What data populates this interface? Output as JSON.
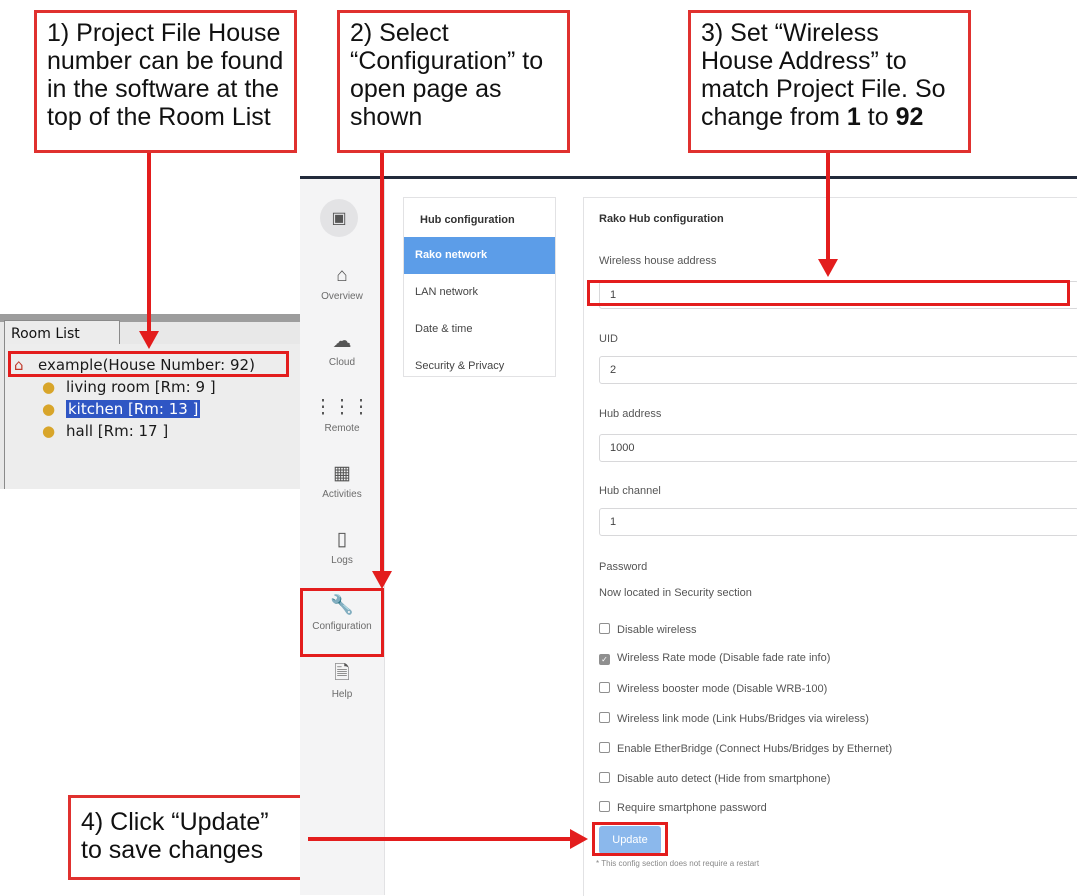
{
  "callouts": {
    "c1": "1) Project File House number can be found in the software at the top of the Room List",
    "c2": "2) Select “Configuration” to open page as shown",
    "c3_pre": "3) Set “Wireless House Address” to match Project File. So change from ",
    "c3_from": "1",
    "c3_mid": " to ",
    "c3_to": "92",
    "c4": "4) Click “Update” to save changes"
  },
  "room_list": {
    "tab": "Room List",
    "house": "example(House Number: 92)",
    "rooms": [
      "living room [Rm: 9 ]",
      "kitchen [Rm: 13 ]",
      "hall [Rm: 17 ]"
    ],
    "selected_room": "kitchen [Rm: 13 ]"
  },
  "nav": {
    "items": [
      {
        "label": "Overview",
        "icon": "home-icon"
      },
      {
        "label": "Cloud",
        "icon": "cloud-icon"
      },
      {
        "label": "Remote",
        "icon": "sliders-icon"
      },
      {
        "label": "Activities",
        "icon": "grid-icon"
      },
      {
        "label": "Logs",
        "icon": "notebook-icon"
      },
      {
        "label": "Configuration",
        "icon": "wrench-icon"
      },
      {
        "label": "Help",
        "icon": "document-icon"
      }
    ],
    "active": "Configuration"
  },
  "subnav": {
    "header": "Hub configuration",
    "items": [
      "Rako network",
      "LAN network",
      "Date & time",
      "Security & Privacy"
    ],
    "active": "Rako network"
  },
  "config": {
    "title": "Rako Hub configuration",
    "wireless_house_address_label": "Wireless house address",
    "wireless_house_address": "1",
    "uid_label": "UID",
    "uid": "2",
    "hub_address_label": "Hub address",
    "hub_address": "1000",
    "hub_channel_label": "Hub channel",
    "hub_channel": "1",
    "password_label": "Password",
    "password_note": "Now located in Security section",
    "options": [
      {
        "label": "Disable wireless",
        "checked": false
      },
      {
        "label": "Wireless Rate mode (Disable fade rate info)",
        "checked": true
      },
      {
        "label": "Wireless booster mode (Disable WRB-100)",
        "checked": false
      },
      {
        "label": "Wireless link mode (Link Hubs/Bridges via wireless)",
        "checked": false
      },
      {
        "label": "Enable EtherBridge (Connect Hubs/Bridges by Ethernet)",
        "checked": false
      },
      {
        "label": "Disable auto detect (Hide from smartphone)",
        "checked": false
      },
      {
        "label": "Require smartphone password",
        "checked": false
      }
    ],
    "update_label": "Update",
    "footnote": "* This config section does not require a restart"
  },
  "colors": {
    "callout_red": "#e31d1d",
    "active_blue": "#5c9de8",
    "button_blue": "#8bb8ec"
  }
}
